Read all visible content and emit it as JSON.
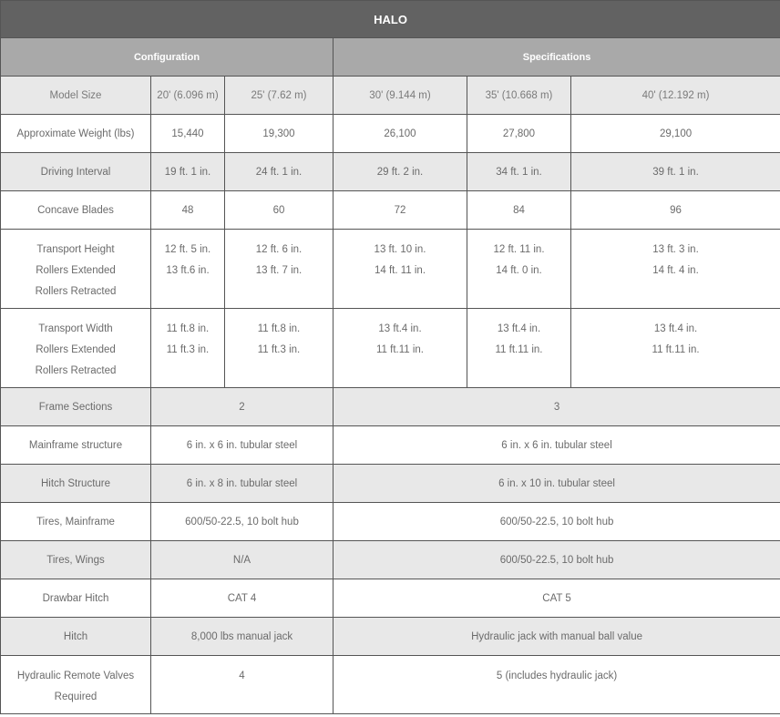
{
  "title": "HALO",
  "groups": {
    "configuration": "Configuration",
    "specifications": "Specifications"
  },
  "model_size": {
    "label": "Model Size",
    "sizes": [
      "20' (6.096 m)",
      "25' (7.62 m)",
      "30' (9.144 m)",
      "35' (10.668 m)",
      "40' (12.192 m)"
    ]
  },
  "weight": {
    "label": "Approximate Weight (lbs)",
    "values": [
      "15,440",
      "19,300",
      "26,100",
      "27,800",
      "29,100"
    ]
  },
  "driving_interval": {
    "label": "Driving Interval",
    "values": [
      "19 ft. 1 in.",
      "24 ft. 1 in.",
      "29 ft. 2 in.",
      "34 ft. 1 in.",
      "39 ft. 1 in."
    ]
  },
  "concave_blades": {
    "label": "Concave Blades",
    "values": [
      "48",
      "60",
      "72",
      "84",
      "96"
    ]
  },
  "transport_height": {
    "labels": [
      "Transport Height",
      "Rollers Extended",
      "Rollers Retracted"
    ],
    "extended": [
      "12 ft. 5 in.",
      "12 ft. 6 in.",
      "13 ft. 10 in.",
      "12 ft. 11 in.",
      "13 ft. 3 in."
    ],
    "retracted": [
      "13 ft.6 in.",
      "13 ft. 7 in.",
      "14 ft. 11 in.",
      "14 ft. 0 in.",
      "14 ft. 4 in."
    ]
  },
  "transport_width": {
    "labels": [
      "Transport Width",
      "Rollers Extended",
      "Rollers Retracted"
    ],
    "extended": [
      "11 ft.8 in.",
      "11 ft.8 in.",
      "13 ft.4 in.",
      "13 ft.4 in.",
      "13 ft.4 in."
    ],
    "retracted": [
      "11 ft.3 in.",
      "11 ft.3 in.",
      "11 ft.11 in.",
      "11 ft.11 in.",
      "11 ft.11 in."
    ]
  },
  "frame_sections": {
    "label": "Frame Sections",
    "config": "2",
    "spec": "3"
  },
  "mainframe_structure": {
    "label": "Mainframe structure",
    "config": "6 in. x 6 in. tubular steel",
    "spec": "6 in. x 6 in. tubular steel"
  },
  "hitch_structure": {
    "label": "Hitch Structure",
    "config": "6 in. x 8 in. tubular steel",
    "spec": "6 in. x 10 in. tubular steel"
  },
  "tires_mainframe": {
    "label": "Tires, Mainframe",
    "config": "600/50-22.5, 10 bolt hub",
    "spec": "600/50-22.5, 10 bolt hub"
  },
  "tires_wings": {
    "label": "Tires, Wings",
    "config": "N/A",
    "spec": "600/50-22.5, 10 bolt hub"
  },
  "drawbar_hitch": {
    "label": "Drawbar Hitch",
    "config": "CAT 4",
    "spec": "CAT 5"
  },
  "hitch": {
    "label": "Hitch",
    "config": "8,000 lbs manual jack",
    "spec": "Hydraulic jack with manual ball value"
  },
  "hydraulic_remote": {
    "labels": [
      "Hydraulic Remote Valves",
      "Required"
    ],
    "config": "4",
    "spec": "5 (includes hydraulic jack)"
  }
}
